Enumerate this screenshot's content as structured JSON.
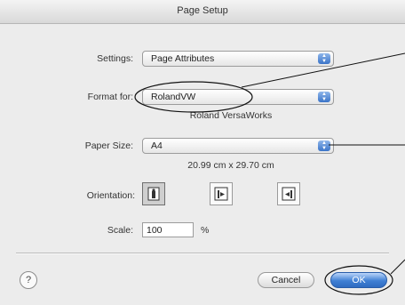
{
  "window": {
    "title": "Page Setup"
  },
  "settings": {
    "label": "Settings:",
    "value": "Page Attributes"
  },
  "format_for": {
    "label": "Format for:",
    "value": "RolandVW",
    "description": "Roland VersaWorks"
  },
  "paper_size": {
    "label": "Paper Size:",
    "value": "A4",
    "dimensions": "20.99 cm x 29.70 cm"
  },
  "orientation": {
    "label": "Orientation:",
    "options": [
      "portrait",
      "landscape",
      "landscape-reversed"
    ],
    "selected": "portrait"
  },
  "scale": {
    "label": "Scale:",
    "value": "100",
    "unit": "%"
  },
  "buttons": {
    "help": "?",
    "cancel": "Cancel",
    "ok": "OK"
  },
  "colors": {
    "accent": "#3f7fd4",
    "window_bg": "#ececec"
  },
  "icons": {
    "popup_arrows": "up-down-arrows-icon",
    "help": "question-mark-icon",
    "orientation": [
      "portrait-person-icon",
      "landscape-person-icon",
      "landscape-reversed-person-icon"
    ]
  }
}
